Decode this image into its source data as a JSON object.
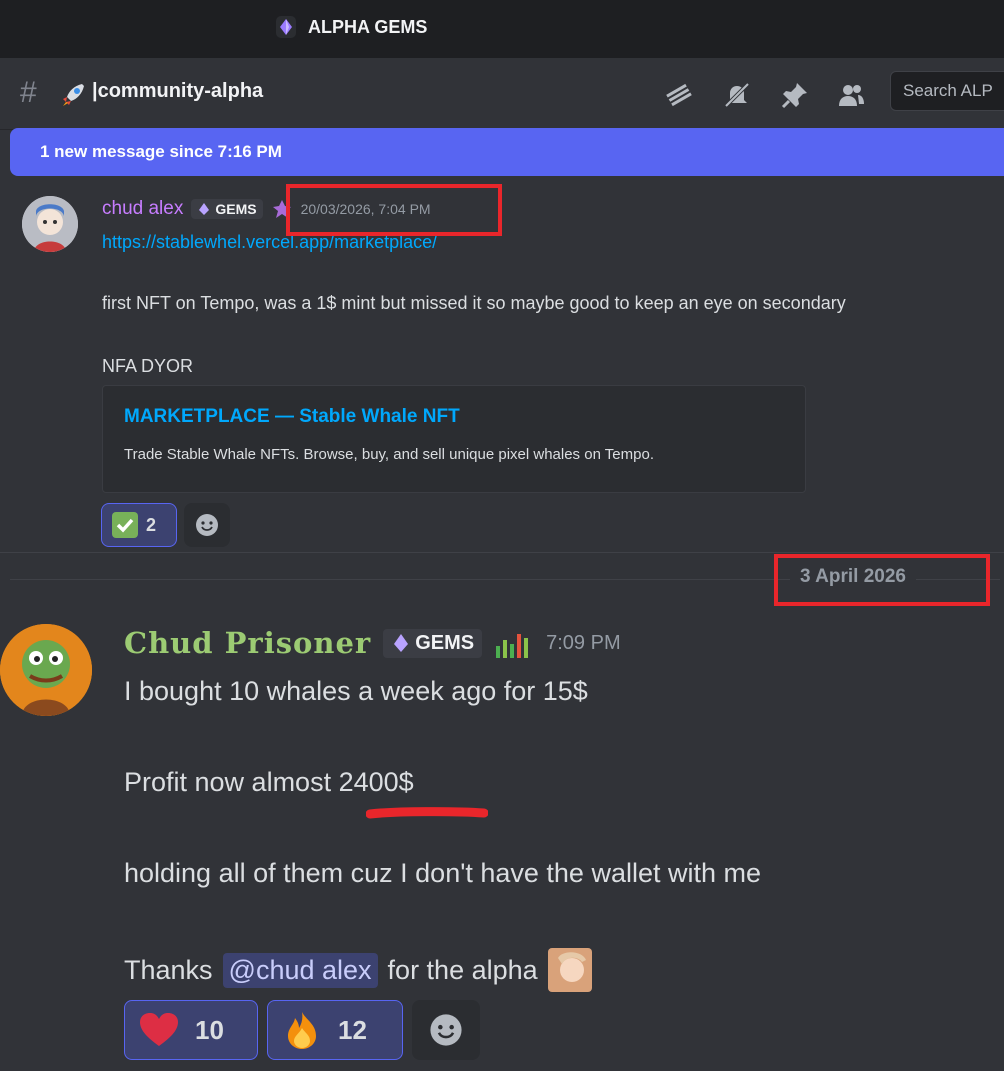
{
  "server": {
    "name": "ALPHA GEMS",
    "icon": "gem-icon"
  },
  "channel": {
    "name": "|community-alpha",
    "prefix": "#",
    "emoji": "rocket-icon"
  },
  "toolbar": {
    "icons": [
      "threads-icon",
      "mute-icon",
      "pin-icon",
      "members-icon"
    ],
    "search_placeholder": "Search ALP"
  },
  "banner": {
    "text": "1 new message since 7:16 PM"
  },
  "message1": {
    "author": "chud alex",
    "tag": "GEMS",
    "timestamp": "20/03/2026, 7:04 PM",
    "link": "https://stablewhel.vercel.app/marketplace/",
    "text1": "first NFT on Tempo, was a 1$ mint but missed it so maybe good to keep an eye on secondary",
    "text2": "NFA DYOR",
    "embed": {
      "title": "MARKETPLACE — Stable Whale NFT",
      "description": "Trade Stable Whale NFTs. Browse, buy, and sell unique pixel whales on Tempo."
    },
    "reactions": [
      {
        "emoji": "check-icon",
        "count": "2"
      }
    ]
  },
  "date_separator": "3 April 2026",
  "message2": {
    "author": "Chud Prisoner",
    "tag": "GEMS",
    "timestamp": "7:09 PM",
    "line1": "I bought 10 whales a week ago for 15$",
    "line2": "Profit now almost 2400$",
    "line3": "holding all of them cuz I don't have the wallet with me",
    "line4_pre": "Thanks",
    "mention": "@chud alex",
    "line4_post": "for the alpha",
    "reactions": [
      {
        "emoji": "heart-icon",
        "count": "10"
      },
      {
        "emoji": "fire-icon",
        "count": "12"
      }
    ]
  },
  "colors": {
    "background": "#313338",
    "blurple": "#5865f2",
    "link": "#00a8fc",
    "highlight_red": "#e9262b",
    "author1": "#c77dff",
    "author2": "#9ccb73"
  }
}
